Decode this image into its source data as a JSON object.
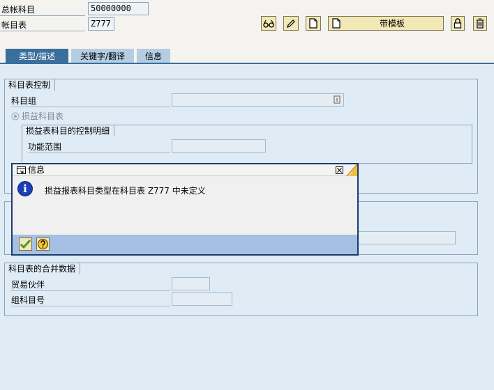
{
  "header": {
    "gl_account_label": "总帐科目",
    "gl_account_value": "50000000",
    "chart_label": "帐目表",
    "chart_value": "Z777"
  },
  "toolbar": {
    "template_label": "带模板"
  },
  "tabs": [
    {
      "label": "类型/描述",
      "active": true
    },
    {
      "label": "关键字/翻译",
      "active": false
    },
    {
      "label": "信息",
      "active": false
    }
  ],
  "control_group": {
    "title": "科目表控制",
    "account_group_label": "科目组",
    "pl_radio_label": "损益科目表",
    "pl_detail": {
      "title": "损益表科目的控制明细",
      "functional_area_label": "功能范围"
    }
  },
  "consolidation_group": {
    "title": "科目表的合并数据",
    "trading_partner_label": "贸易伙伴",
    "group_account_label": "组科目号"
  },
  "dialog": {
    "title": "信息",
    "message": "损益报表科目类型在科目表 Z777 中未定义"
  },
  "colors": {
    "tab_active": "#3a6e9c",
    "dialog_border": "#1c3d6c",
    "info_icon": "#1a3fb5",
    "toolbar_button": "#f1e8b6"
  }
}
